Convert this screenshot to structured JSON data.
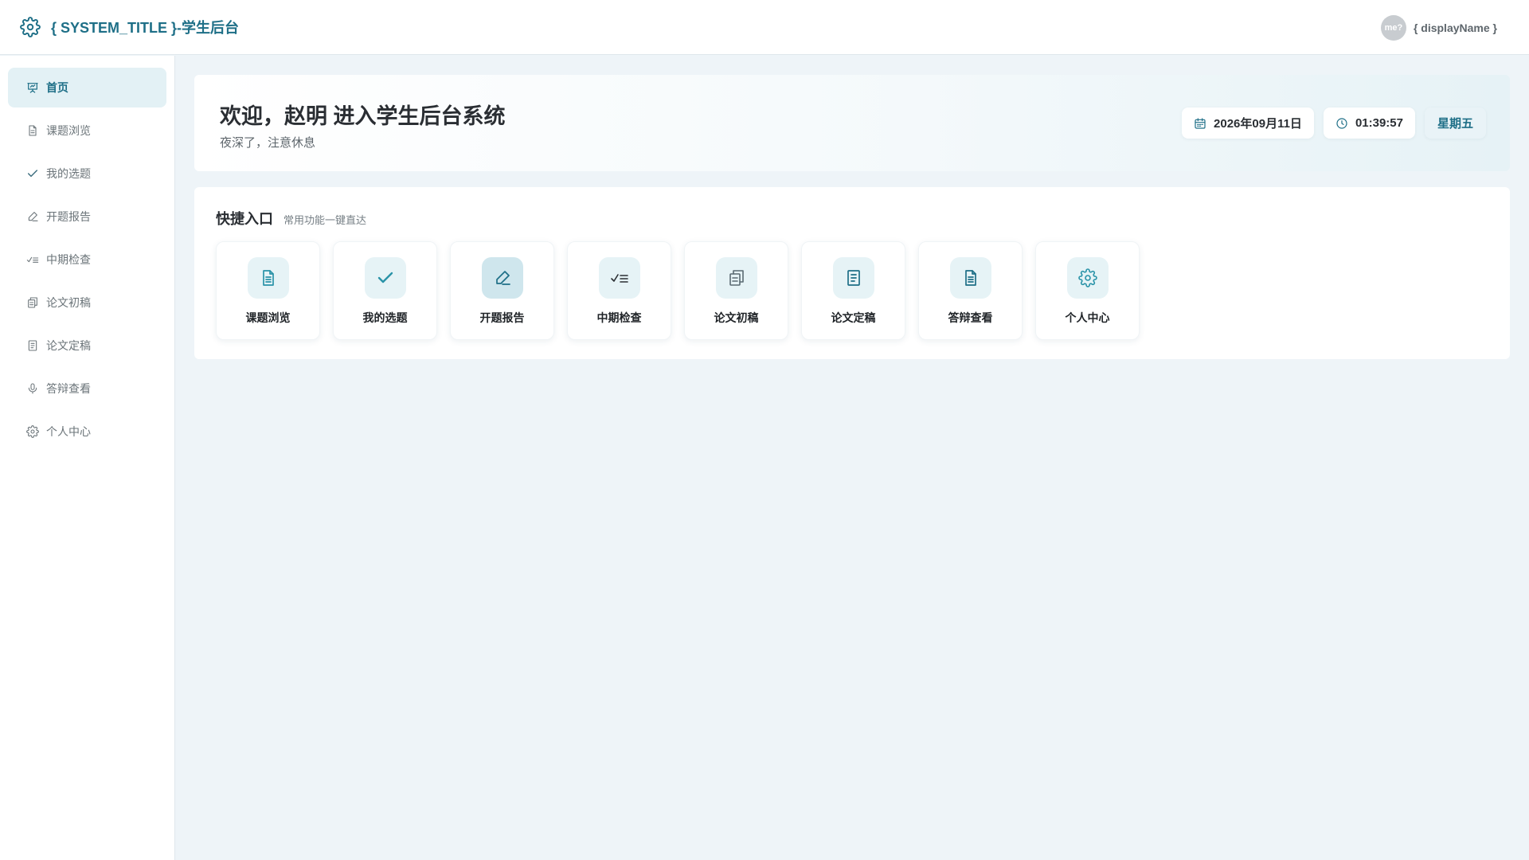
{
  "header": {
    "title": "{ SYSTEM_TITLE }-学生后台",
    "avatar_text": "me?",
    "display_name": "{ displayName }"
  },
  "sidebar": {
    "items": [
      {
        "label": "首页",
        "icon": "presentation-icon",
        "active": true
      },
      {
        "label": "课题浏览",
        "icon": "document-icon"
      },
      {
        "label": "我的选题",
        "icon": "check-icon"
      },
      {
        "label": "开题报告",
        "icon": "edit-icon"
      },
      {
        "label": "中期检查",
        "icon": "checklist-icon"
      },
      {
        "label": "论文初稿",
        "icon": "copy-icon"
      },
      {
        "label": "论文定稿",
        "icon": "document-icon"
      },
      {
        "label": "答辩查看",
        "icon": "microphone-icon"
      },
      {
        "label": "个人中心",
        "icon": "gear-icon"
      }
    ]
  },
  "welcome": {
    "title": "欢迎，赵明 进入学生后台系统",
    "subtitle": "夜深了，注意休息",
    "date": "2026年09月11日",
    "time": "01:39:57",
    "weekday": "星期五"
  },
  "quick": {
    "title": "快捷入口",
    "subtitle": "常用功能一键直达",
    "items": [
      {
        "label": "课题浏览",
        "icon": "document-icon"
      },
      {
        "label": "我的选题",
        "icon": "check-icon"
      },
      {
        "label": "开题报告",
        "icon": "edit-icon",
        "highlighted": true
      },
      {
        "label": "中期检查",
        "icon": "checklist-icon"
      },
      {
        "label": "论文初稿",
        "icon": "copy-icon"
      },
      {
        "label": "论文定稿",
        "icon": "document-icon"
      },
      {
        "label": "答辩查看",
        "icon": "document-icon"
      },
      {
        "label": "个人中心",
        "icon": "gear-icon"
      }
    ]
  },
  "colors": {
    "accent": "#1e6f87",
    "icon_teal": "#2a93a8",
    "active_bg": "#e3f1f5",
    "page_bg": "#eef4f8"
  }
}
